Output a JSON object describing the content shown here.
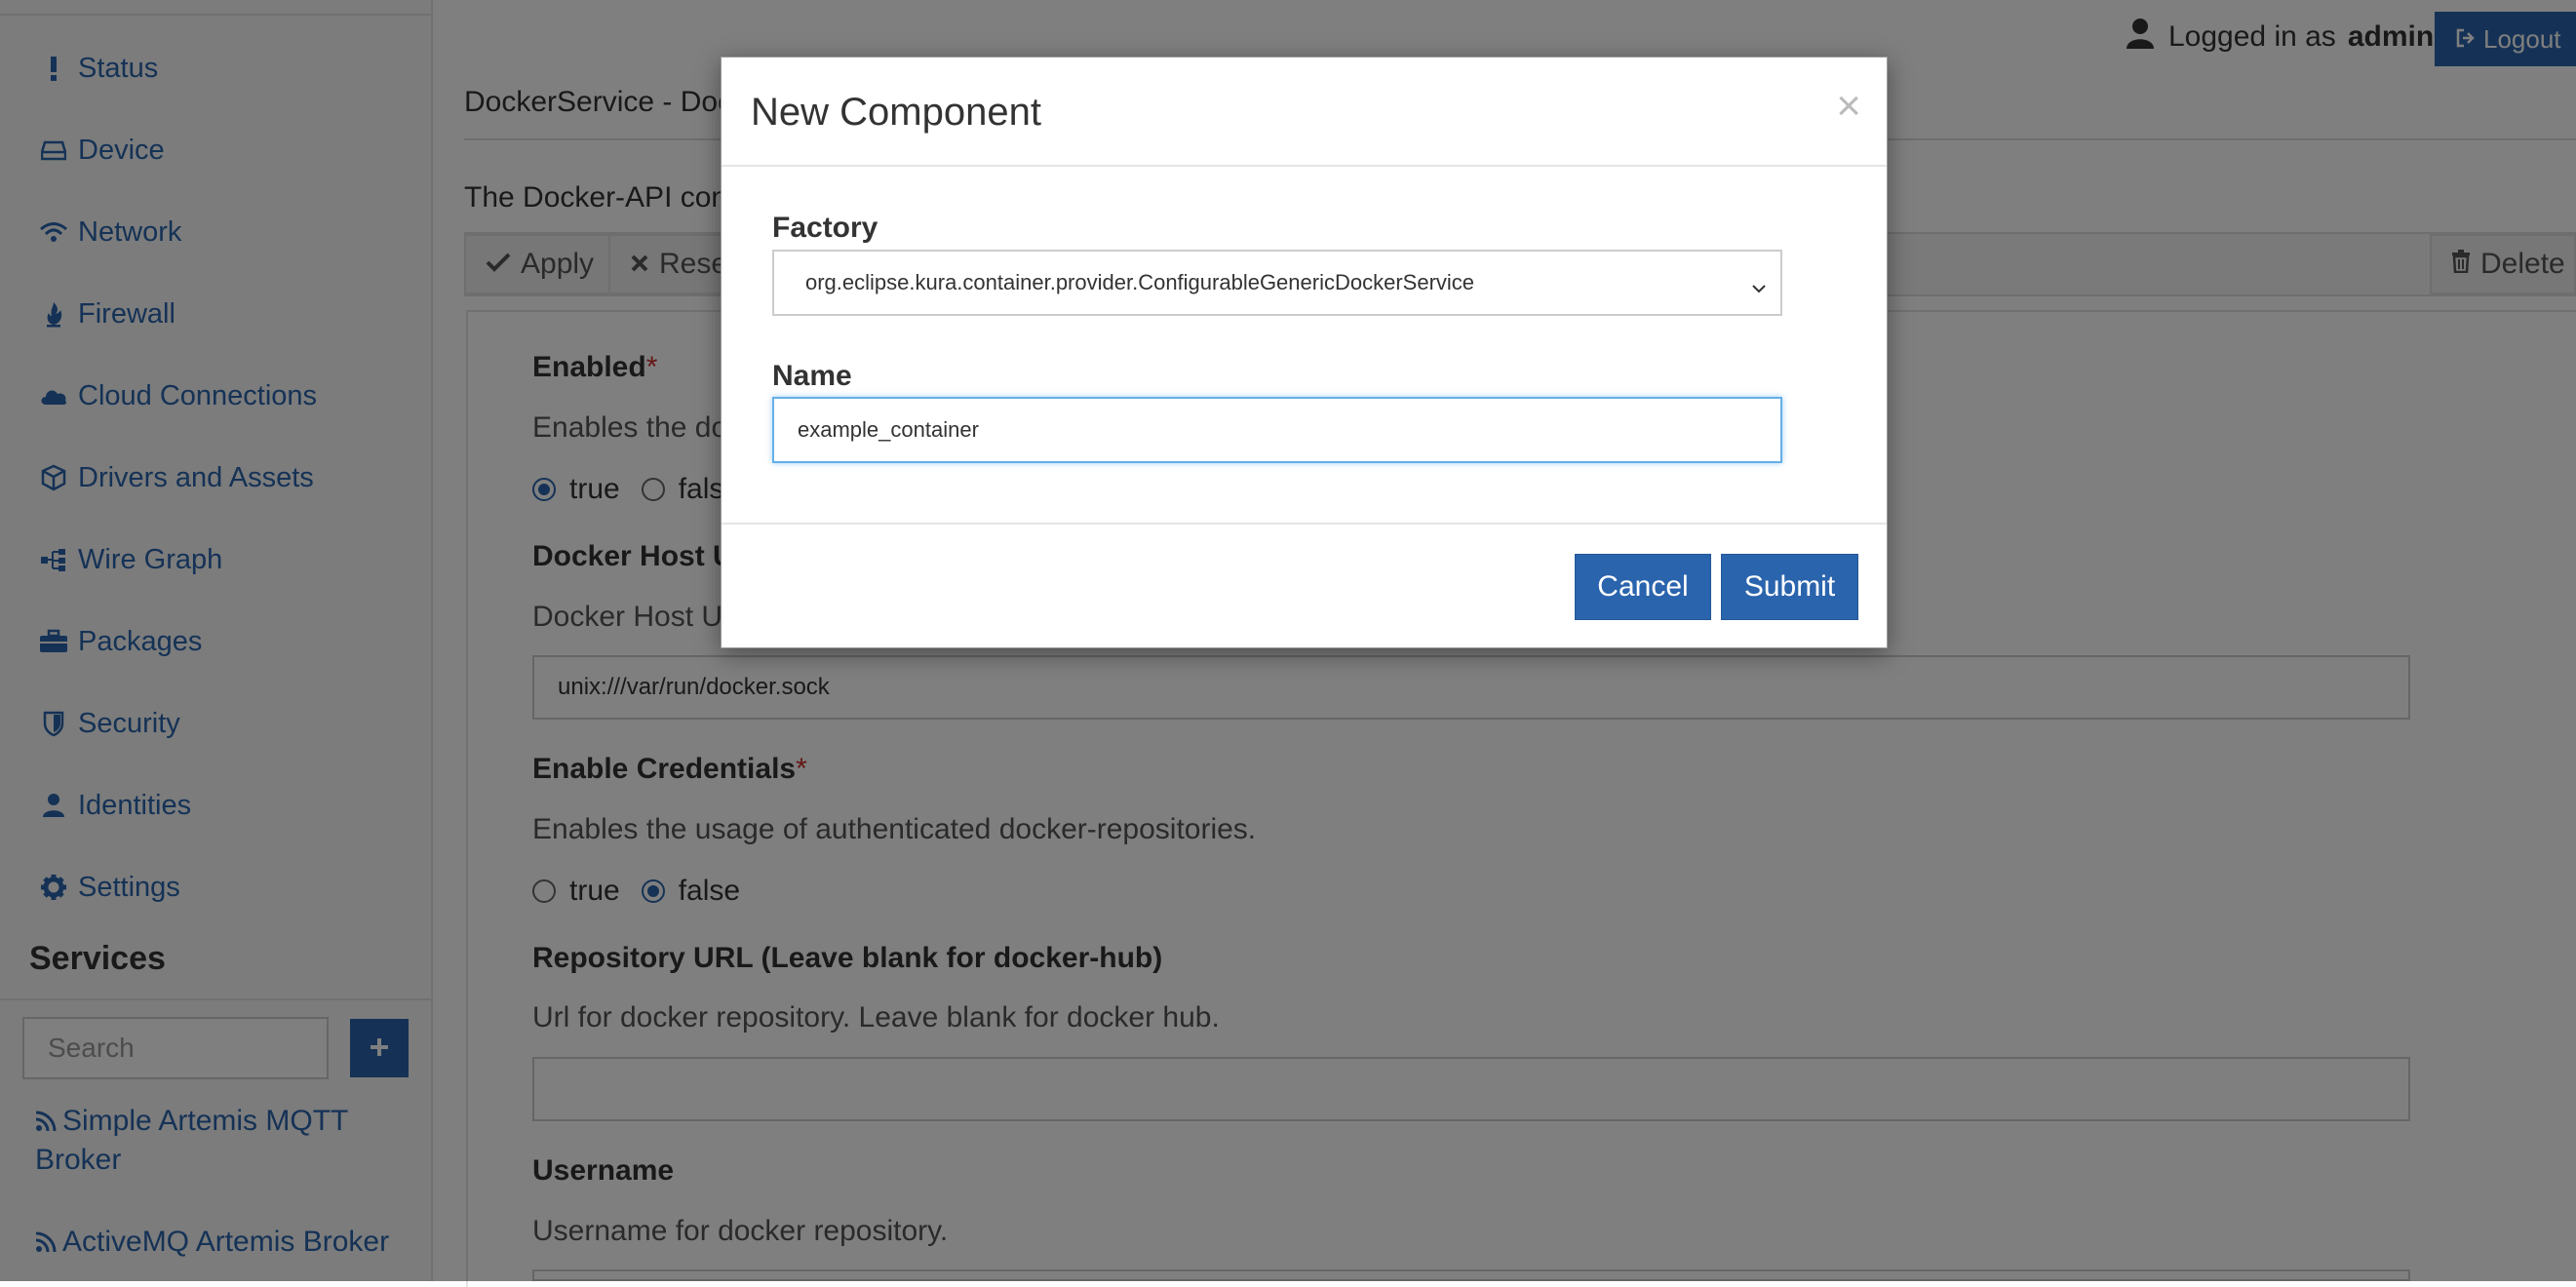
{
  "header": {
    "logged_in_prefix": "Logged in as",
    "username": "admin",
    "logout_label": "Logout"
  },
  "sidebar": {
    "items": [
      {
        "label": "Status",
        "icon": "exclamation-icon"
      },
      {
        "label": "Device",
        "icon": "hdd-icon"
      },
      {
        "label": "Network",
        "icon": "wifi-icon"
      },
      {
        "label": "Firewall",
        "icon": "fire-icon"
      },
      {
        "label": "Cloud Connections",
        "icon": "cloud-icon"
      },
      {
        "label": "Drivers and Assets",
        "icon": "cube-icon"
      },
      {
        "label": "Wire Graph",
        "icon": "graph-icon"
      },
      {
        "label": "Packages",
        "icon": "briefcase-icon"
      },
      {
        "label": "Security",
        "icon": "shield-icon"
      },
      {
        "label": "Identities",
        "icon": "user-icon"
      },
      {
        "label": "Settings",
        "icon": "gear-icon"
      }
    ],
    "services_title": "Services",
    "search_placeholder": "Search",
    "services": [
      {
        "label": "Simple Artemis MQTT Broker",
        "icon": "rss-icon"
      },
      {
        "label": "ActiveMQ Artemis Broker",
        "icon": "rss-icon"
      }
    ]
  },
  "main": {
    "title": "DockerService - Doc",
    "intro": "The Docker-API conn",
    "toolbar": {
      "apply": "Apply",
      "reset": "Rese",
      "delete": "Delete"
    },
    "fields": {
      "enabled": {
        "label": "Enabled",
        "required": "*",
        "desc": "Enables the doc",
        "true_label": "true",
        "false_label": "fals"
      },
      "docker_host": {
        "label": "Docker Host U",
        "desc": "Docker Host UR",
        "value": "unix:///var/run/docker.sock"
      },
      "enable_credentials": {
        "label": "Enable Credentials",
        "required": "*",
        "desc": "Enables the usage of authenticated docker-repositories.",
        "true_label": "true",
        "false_label": "false"
      },
      "repository_url": {
        "label": "Repository URL (Leave blank for docker-hub)",
        "desc": "Url for docker repository. Leave blank for docker hub.",
        "value": ""
      },
      "username": {
        "label": "Username",
        "desc": "Username for docker repository.",
        "value": ""
      }
    }
  },
  "modal": {
    "title": "New Component",
    "close": "×",
    "factory_label": "Factory",
    "factory_value": "org.eclipse.kura.container.provider.ConfigurableGenericDockerService",
    "name_label": "Name",
    "name_value": "example_container",
    "cancel_label": "Cancel",
    "submit_label": "Submit"
  },
  "colors": {
    "accent": "#2a64ad",
    "required": "#c9302c",
    "focus": "#66afe9"
  }
}
